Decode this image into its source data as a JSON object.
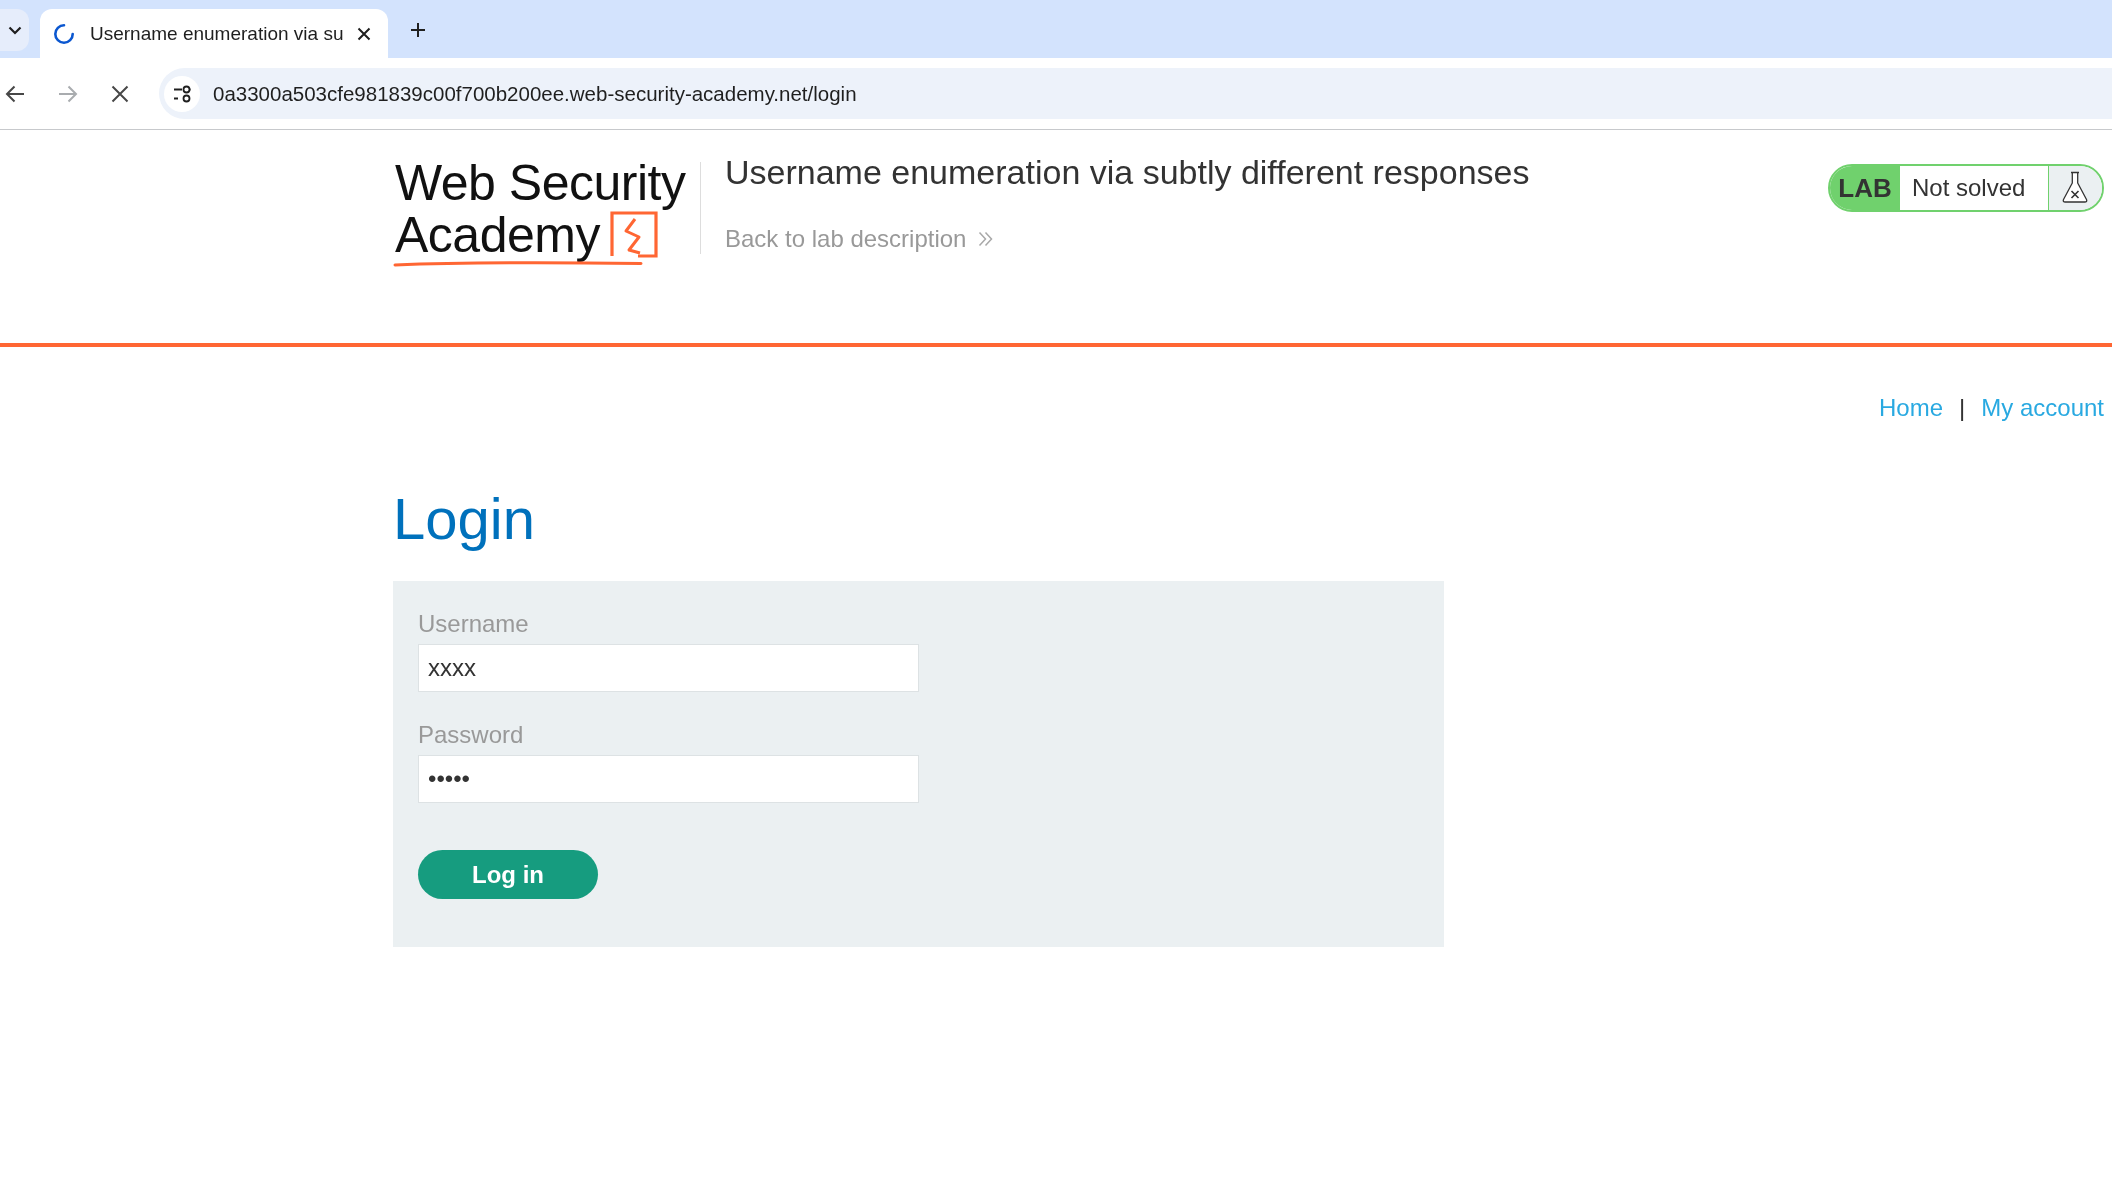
{
  "browser": {
    "tabs": [
      {
        "title": "Username enumeration via su",
        "selected": true,
        "loading": true
      }
    ],
    "nav_buttons": [
      {
        "kind": "back",
        "disabled": false
      },
      {
        "kind": "forward",
        "disabled": true
      },
      {
        "kind": "stop",
        "disabled": false
      }
    ],
    "url": "0a3300a503cfe981839c00f700b200ee.web-security-academy.net/login"
  },
  "header": {
    "logo_lines": [
      "Web Security",
      "Academy"
    ],
    "title": "Username enumeration via subtly different responses",
    "back_link": "Back to lab description",
    "lab_badge": {
      "label": "LAB",
      "status": "Not solved",
      "solved": false
    }
  },
  "nav": {
    "links": [
      {
        "label": "Home"
      },
      {
        "label": "My account"
      }
    ],
    "separator": "|"
  },
  "login": {
    "heading": "Login",
    "fields": [
      {
        "label": "Username",
        "value": "xxxx"
      },
      {
        "label": "Password",
        "value": "•••••"
      }
    ],
    "button": "Log in"
  }
}
